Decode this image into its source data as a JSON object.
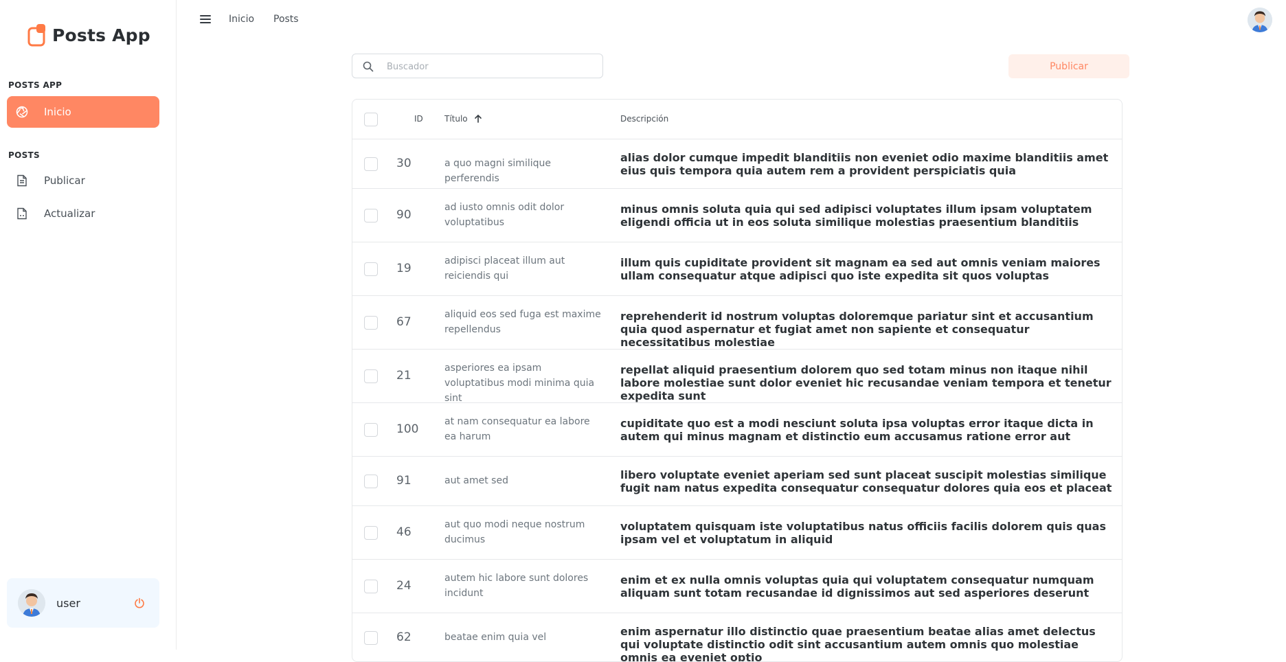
{
  "app": {
    "name": "Posts App"
  },
  "sidebar": {
    "sections": [
      {
        "label": "POSTS APP",
        "items": [
          {
            "label": "Inicio",
            "icon": "aperture-icon",
            "active": true
          }
        ]
      },
      {
        "label": "POSTS",
        "items": [
          {
            "label": "Publicar",
            "icon": "document-icon",
            "active": false
          },
          {
            "label": "Actualizar",
            "icon": "document-icon",
            "active": false
          }
        ]
      }
    ],
    "user": {
      "name": "user"
    }
  },
  "topbar": {
    "breadcrumbs": [
      "Inicio",
      "Posts"
    ]
  },
  "search": {
    "placeholder": "Buscador",
    "value": ""
  },
  "publish_button": {
    "label": "Publicar"
  },
  "table": {
    "columns": {
      "id": "ID",
      "title": "Título",
      "description": "Descripción"
    },
    "sort": {
      "column": "title",
      "direction": "asc"
    },
    "rows": [
      {
        "id": "30",
        "title": "a quo magni similique perferendis",
        "description": "alias dolor cumque impedit blanditiis non eveniet odio maxime blanditiis amet eius quis tempora quia autem rem a provident perspiciatis quia"
      },
      {
        "id": "90",
        "title": "ad iusto omnis odit dolor voluptatibus",
        "description": "minus omnis soluta quia qui sed adipisci voluptates illum ipsam voluptatem eligendi officia ut in eos soluta similique molestias praesentium blanditiis"
      },
      {
        "id": "19",
        "title": "adipisci placeat illum aut reiciendis qui",
        "description": "illum quis cupiditate provident sit magnam ea sed aut omnis veniam maiores ullam consequatur atque adipisci quo iste expedita sit quos voluptas"
      },
      {
        "id": "67",
        "title": "aliquid eos sed fuga est maxime repellendus",
        "description": "reprehenderit id nostrum voluptas doloremque pariatur sint et accusantium quia quod aspernatur et fugiat amet non sapiente et consequatur necessitatibus molestiae"
      },
      {
        "id": "21",
        "title": "asperiores ea ipsam voluptatibus modi minima quia sint",
        "description": "repellat aliquid praesentium dolorem quo sed totam minus non itaque nihil labore molestiae sunt dolor eveniet hic recusandae veniam tempora et tenetur expedita sunt"
      },
      {
        "id": "100",
        "title": "at nam consequatur ea labore ea harum",
        "description": "cupiditate quo est a modi nesciunt soluta ipsa voluptas error itaque dicta in autem qui minus magnam et distinctio eum accusamus ratione error aut"
      },
      {
        "id": "91",
        "title": "aut amet sed",
        "description": "libero voluptate eveniet aperiam sed sunt placeat suscipit molestias similique fugit nam natus expedita consequatur consequatur dolores quia eos et placeat"
      },
      {
        "id": "46",
        "title": "aut quo modi neque nostrum ducimus",
        "description": "voluptatem quisquam iste voluptatibus natus officiis facilis dolorem quis quas ipsam vel et voluptatum in aliquid"
      },
      {
        "id": "24",
        "title": "autem hic labore sunt dolores incidunt",
        "description": "enim et ex nulla omnis voluptas quia qui voluptatem consequatur numquam aliquam sunt totam recusandae id dignissimos aut sed asperiores deserunt"
      },
      {
        "id": "62",
        "title": "beatae enim quia vel",
        "description": "enim aspernatur illo distinctio quae praesentium beatae alias amet delectus qui voluptate distinctio odit sint accusantium autem omnis quo molestiae omnis ea eveniet optio"
      }
    ]
  },
  "colors": {
    "accent": "#ff8763",
    "accent_soft": "#fff0ea",
    "user_card_bg": "#f1f8ff",
    "border": "#e6e8ea"
  }
}
